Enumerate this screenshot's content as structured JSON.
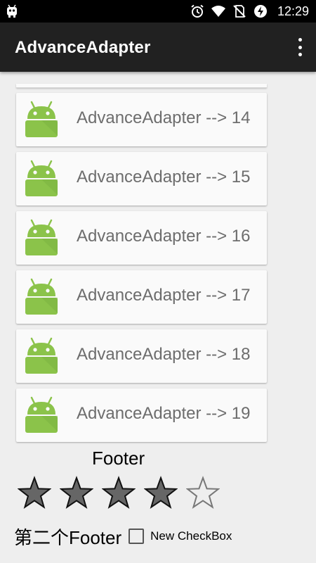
{
  "status_bar": {
    "time": "12:29",
    "icons": [
      "android-debug-icon",
      "alarm-icon",
      "wifi-icon",
      "no-sim-icon",
      "battery-charging-icon"
    ]
  },
  "app_bar": {
    "title": "AdvanceAdapter",
    "overflow_icon": "overflow-menu-icon"
  },
  "list": {
    "items": [
      {
        "label": "AdvanceAdapter  -->  14",
        "icon": "android-robot-icon"
      },
      {
        "label": "AdvanceAdapter  -->  15",
        "icon": "android-robot-icon"
      },
      {
        "label": "AdvanceAdapter  -->  16",
        "icon": "android-robot-icon"
      },
      {
        "label": "AdvanceAdapter  -->  17",
        "icon": "android-robot-icon"
      },
      {
        "label": "AdvanceAdapter  -->  18",
        "icon": "android-robot-icon"
      },
      {
        "label": "AdvanceAdapter  -->  19",
        "icon": "android-robot-icon"
      }
    ]
  },
  "footer": {
    "label": "Footer",
    "rating": {
      "value": 4,
      "max": 5
    }
  },
  "second_footer": {
    "label": "第二个Footer",
    "checkbox_label": "New CheckBox",
    "checked": false
  },
  "colors": {
    "status_bar": "#000000",
    "app_bar": "#212121",
    "background": "#eeeeee",
    "card": "#fafafa",
    "android_green": "#8bc34a",
    "star_fill": "#666666"
  }
}
